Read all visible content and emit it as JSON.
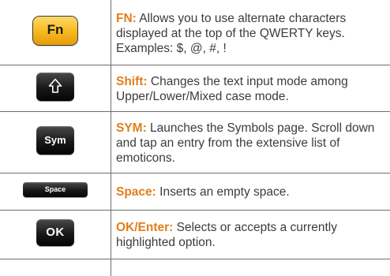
{
  "rows": [
    {
      "key_label": "Fn",
      "term": "FN:",
      "description": " Allows you to use alternate characters displayed at the top of the QWERTY keys. Examples: $, @, #, !"
    },
    {
      "key_label": "",
      "term": "Shift:",
      "description": " Changes the text input mode among Upper/Lower/Mixed case mode."
    },
    {
      "key_label": "Sym",
      "term": "SYM:",
      "description": " Launches the Symbols page. Scroll down and tap an entry from the extensive list of emoticons."
    },
    {
      "key_label": "Space",
      "term": "Space:",
      "description": " Inserts an empty space."
    },
    {
      "key_label": "OK",
      "term": "OK/Enter:",
      "description": " Selects or accepts a currently highlighted option."
    }
  ],
  "icons": {
    "shift_key": "shift-arrow-icon"
  },
  "colors": {
    "term": "#e07e1c",
    "text": "#3c3c3c",
    "rule": "#6d6d6d",
    "fn_key": "#f5b81e",
    "dark_key": "#1a1a1a"
  }
}
